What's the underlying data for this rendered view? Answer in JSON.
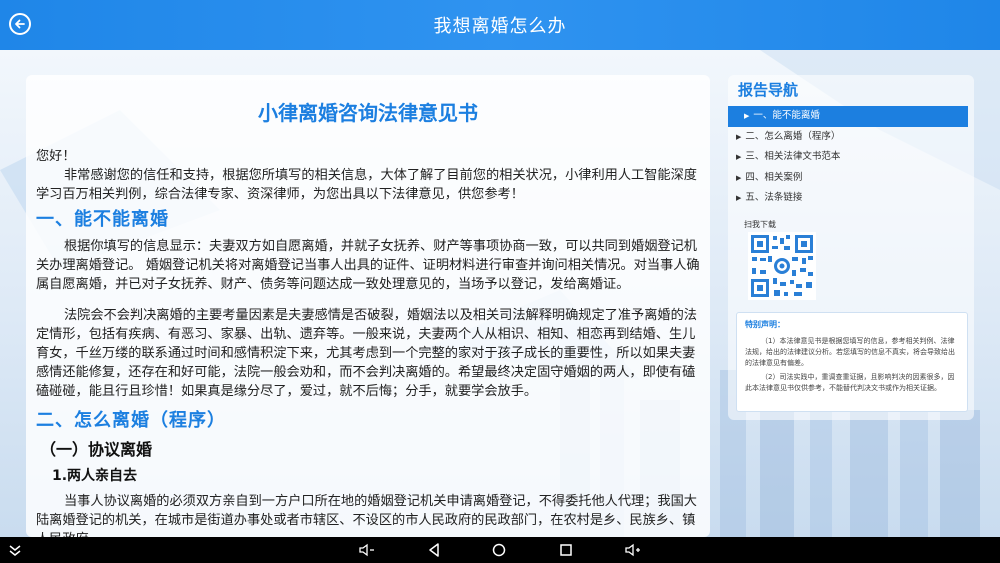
{
  "header": {
    "title": "我想离婚怎么办"
  },
  "document": {
    "title": "小律离婚咨询法律意见书",
    "greeting": "您好！",
    "intro": "非常感谢您的信任和支持，根据您所填写的相关信息，大体了解了目前您的相关状况，小律利用人工智能深度学习百万相关判例，综合法律专家、资深律师，为您出具以下法律意见，供您参考！",
    "section1": {
      "heading": "一、能不能离婚",
      "para1": "根据你填写的信息显示：夫妻双方如自愿离婚，并就子女抚养、财产等事项协商一致，可以共同到婚姻登记机关办理离婚登记。 婚姻登记机关将对离婚登记当事人出具的证件、证明材料进行审查并询问相关情况。对当事人确属自愿离婚，并已对子女抚养、财产、债务等问题达成一致处理意见的，当场予以登记，发给离婚证。",
      "para2": "法院会不会判决离婚的主要考量因素是夫妻感情是否破裂，婚姻法以及相关司法解释明确规定了准予离婚的法定情形，包括有疾病、有恶习、家暴、出轨、遗弃等。一般来说，夫妻两个人从相识、相知、相恋再到结婚、生儿育女，千丝万缕的联系通过时间和感情积淀下来，尤其考虑到一个完整的家对于孩子成长的重要性，所以如果夫妻感情还能修复，还存在和好可能，法院一般会劝和，而不会判决离婚的。希望最终决定固守婚姻的两人，即使有磕磕碰碰，能且行且珍惜！如果真是缘分尽了，爱过，就不后悔；分手，就要学会放手。"
    },
    "section2": {
      "heading": "二、怎么离婚（程序）",
      "sub1": "（一）协议离婚",
      "sub1_1": "1.两人亲自去",
      "para1": "当事人协议离婚的必须双方亲自到一方户口所在地的婚姻登记机关申请离婚登记，不得委托他人代理；我国大陆离婚登记的机关，在城市是街道办事处或者市辖区、不设区的市人民政府的民政部门，在农村是乡、民族乡、镇人民政府。"
    }
  },
  "sidebar": {
    "title": "报告导航",
    "items": [
      {
        "label": "一、能不能离婚",
        "active": true
      },
      {
        "label": "二、怎么离婚（程序）",
        "active": false
      },
      {
        "label": "三、相关法律文书范本",
        "active": false
      },
      {
        "label": "四、相关案例",
        "active": false
      },
      {
        "label": "五、法条链接",
        "active": false
      }
    ],
    "qr_label": "扫我下载",
    "disclaimer": {
      "title": "特别声明：",
      "p1": "（1）本法律意见书是根据您填写的信息，参考相关判例、法律法规，给出的法律建议分析。若您填写的信息不真实，将会导致给出的法律意见有偏差。",
      "p2": "（2）司法实践中，重调查重证据，且影响判决的因素很多，因此本法律意见书仅供参考，不能替代判决文书或作为相关证据。"
    }
  },
  "navbar": {
    "icons": [
      "chevron-down-icon",
      "volume-down-icon",
      "back-triangle-icon",
      "home-circle-icon",
      "recent-square-icon",
      "volume-up-icon"
    ]
  },
  "colors": {
    "accent": "#1c7fe0",
    "header": "#2f93f0",
    "navbar": "#000000"
  }
}
